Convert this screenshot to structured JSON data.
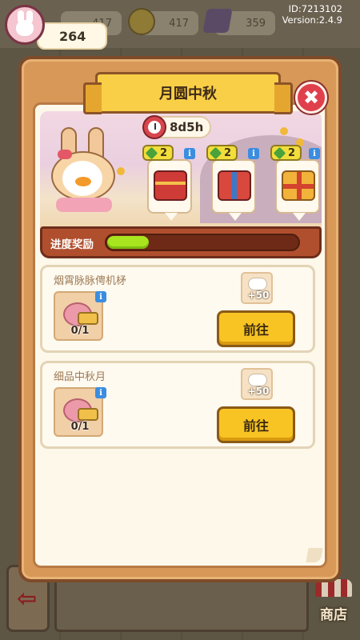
{
  "hud": {
    "level": "264",
    "resources": [
      {
        "name": "energy",
        "value": "417"
      },
      {
        "name": "coins",
        "value": "417"
      },
      {
        "name": "gems",
        "value": "359"
      }
    ],
    "id_text": "ID:7213102",
    "version_text": "Version:2.4.9"
  },
  "modal": {
    "title": "月圆中秋",
    "close_label": "✖",
    "timer": "8d5h",
    "rewards": [
      {
        "count": "2",
        "icon": "red-chest-icon",
        "info": "i"
      },
      {
        "count": "2",
        "icon": "gift-box-icon",
        "info": "i"
      },
      {
        "count": "2",
        "icon": "gold-gift-icon",
        "info": "i"
      }
    ],
    "progress": {
      "label": "进度奖励",
      "value": 0.22,
      "color": "#a9e51f"
    },
    "tasks": [
      {
        "title": "烟霄脉脉俜机柕",
        "count": "0/1",
        "reward": "+50",
        "info": "i",
        "button": "前往"
      },
      {
        "title": "细品中秋月",
        "count": "0/1",
        "reward": "+50",
        "info": "i",
        "button": "前往"
      }
    ]
  },
  "bottom": {
    "shop_label": "商店",
    "back_icon": "exit-arrow-icon"
  },
  "colors": {
    "modal_frame": "#d79858",
    "title_ribbon": "#f8cf46",
    "go_button": "#f8c423",
    "close_button": "#e0404c"
  }
}
